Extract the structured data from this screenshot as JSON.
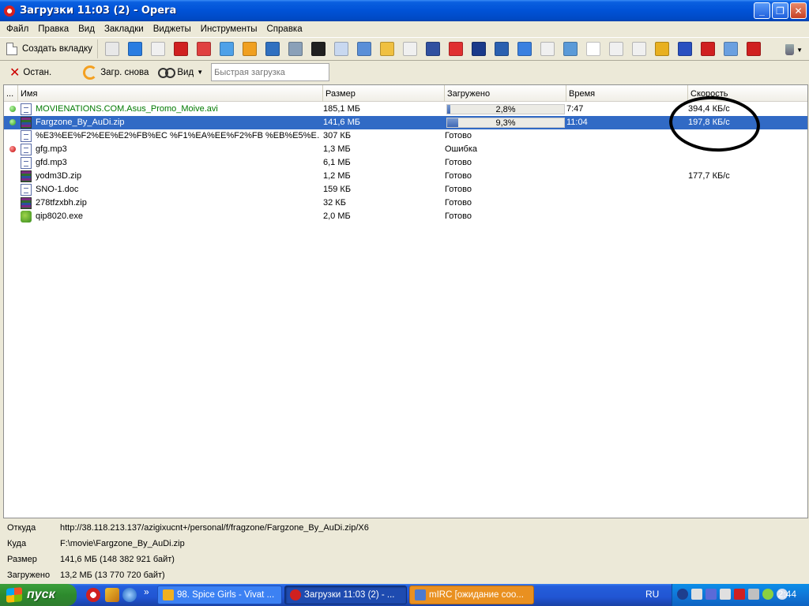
{
  "window": {
    "title": "Загрузки 11:03 (2) - Opera",
    "minimize": "_",
    "maximize": "❐",
    "close": "✕"
  },
  "menu": [
    "Файл",
    "Правка",
    "Вид",
    "Закладки",
    "Виджеты",
    "Инструменты",
    "Справка"
  ],
  "toolbar": {
    "new_tab_label": "Создать вкладку",
    "panel_icons": [
      {
        "name": "page-icon",
        "color": "#e8e8e8"
      },
      {
        "name": "google-icon",
        "color": "#2a7de1"
      },
      {
        "name": "page-icon",
        "color": "#f0f0f0"
      },
      {
        "name": "arch-icon",
        "color": "#d02020"
      },
      {
        "name": "x-icon",
        "color": "#e04040"
      },
      {
        "name": "z-icon",
        "color": "#4ea1e8"
      },
      {
        "name": "torch-icon",
        "color": "#f0a020"
      },
      {
        "name": "link-icon",
        "color": "#3070c0"
      },
      {
        "name": "satellite-icon",
        "color": "#8aa0b8"
      },
      {
        "name": "c58-icon",
        "color": "#202020"
      },
      {
        "name": "blank-icon",
        "color": "#c8d8f0"
      },
      {
        "name": "network-icon",
        "color": "#5a8fd8"
      },
      {
        "name": "people-icon",
        "color": "#f0c040"
      },
      {
        "name": "page-icon",
        "color": "#f0f0f0"
      },
      {
        "name": "u-icon",
        "color": "#3050a0"
      },
      {
        "name": "puzzle-icon",
        "color": "#e03030"
      },
      {
        "name": "chart-line-icon",
        "color": "#1a3a8a"
      },
      {
        "name": "capsule-icon",
        "color": "#2a60b0"
      },
      {
        "name": "cursor-icon",
        "color": "#3a80e0"
      },
      {
        "name": "page-icon",
        "color": "#f0f0f0"
      },
      {
        "name": "wave-icon",
        "color": "#5a9ad8"
      },
      {
        "name": "linkedin-icon",
        "color": "#ffffff"
      },
      {
        "name": "flickr-icon",
        "color": "#f0f0f0"
      },
      {
        "name": "page-icon",
        "color": "#f0f0f0"
      },
      {
        "name": "pencil-icon",
        "color": "#e8b020"
      },
      {
        "name": "bars-icon",
        "color": "#2a50c0"
      },
      {
        "name": "opera-icon",
        "color": "#d02020"
      },
      {
        "name": "target-icon",
        "color": "#6aa0e0"
      },
      {
        "name": "youtube-icon",
        "color": "#d02020"
      }
    ]
  },
  "actions": {
    "stop_label": "Остан.",
    "reload_label": "Загр. снова",
    "view_label": "Вид",
    "quick_load_placeholder": "Быстрая загрузка"
  },
  "columns": {
    "marker": "...",
    "name": "Имя",
    "size": "Размер",
    "loaded": "Загружено",
    "time": "Время",
    "speed": "Скорость"
  },
  "downloads": [
    {
      "status": "green",
      "icon": "file",
      "name": "MOVIENATIONS.COM.Asus_Promo_Moive.avi",
      "size": "185,1 МБ",
      "loaded": "2,8%",
      "progress": 0.028,
      "time": "7:47",
      "speed": "394,4 КБ/с",
      "selected": false,
      "green_name": true
    },
    {
      "status": "green",
      "icon": "zip",
      "name": "Fargzone_By_AuDi.zip",
      "size": "141,6 МБ",
      "loaded": "9,3%",
      "progress": 0.093,
      "time": "11:04",
      "speed": "197,8 КБ/с",
      "selected": true,
      "green_name": false
    },
    {
      "status": "",
      "icon": "file",
      "name": "%E3%EE%F2%EE%E2%FB%EC %F1%EA%EE%F2%FB %EB%E5%E…",
      "size": "307 КБ",
      "loaded": "Готово",
      "progress": null,
      "time": "",
      "speed": "",
      "selected": false,
      "green_name": false
    },
    {
      "status": "red",
      "icon": "file",
      "name": "gfg.mp3",
      "size": "1,3 МБ",
      "loaded": "Ошибка",
      "progress": null,
      "time": "",
      "speed": "",
      "selected": false,
      "green_name": false
    },
    {
      "status": "",
      "icon": "file",
      "name": "gfd.mp3",
      "size": "6,1 МБ",
      "loaded": "Готово",
      "progress": null,
      "time": "",
      "speed": "",
      "selected": false,
      "green_name": false
    },
    {
      "status": "",
      "icon": "zip",
      "name": "yodm3D.zip",
      "size": "1,2 МБ",
      "loaded": "Готово",
      "progress": null,
      "time": "",
      "speed": "177,7 КБ/с",
      "selected": false,
      "green_name": false
    },
    {
      "status": "",
      "icon": "file",
      "name": "SNO-1.doc",
      "size": "159 КБ",
      "loaded": "Готово",
      "progress": null,
      "time": "",
      "speed": "",
      "selected": false,
      "green_name": false
    },
    {
      "status": "",
      "icon": "zip",
      "name": "278tfzxbh.zip",
      "size": "32 КБ",
      "loaded": "Готово",
      "progress": null,
      "time": "",
      "speed": "",
      "selected": false,
      "green_name": false
    },
    {
      "status": "",
      "icon": "exe",
      "name": "qip8020.exe",
      "size": "2,0 МБ",
      "loaded": "Готово",
      "progress": null,
      "time": "",
      "speed": "",
      "selected": false,
      "green_name": false
    }
  ],
  "details": [
    {
      "key": "Откуда",
      "value": "http://38.118.213.137/azigixucnt+/personal/f/fragzone/Fargzone_By_AuDi.zip/X6"
    },
    {
      "key": "Куда",
      "value": "F:\\movie\\Fargzone_By_AuDi.zip"
    },
    {
      "key": "Размер",
      "value": "141,6 МБ (148 382 921 байт)"
    },
    {
      "key": "Загружено",
      "value": "13,2 МБ (13 770 720 байт)"
    }
  ],
  "taskbar": {
    "start_label": "пуск",
    "quicklaunch_more": "»",
    "tasks": [
      {
        "label": "98. Spice Girls - Vivat ...",
        "icon_color": "#f0b020"
      },
      {
        "label": "Загрузки 11:03 (2) - ...",
        "icon_color": "#d02020"
      },
      {
        "label": "mIRC [ожидание соо...",
        "icon_color": "#4a7ad0"
      }
    ],
    "language": "RU",
    "clock": "2:44"
  }
}
